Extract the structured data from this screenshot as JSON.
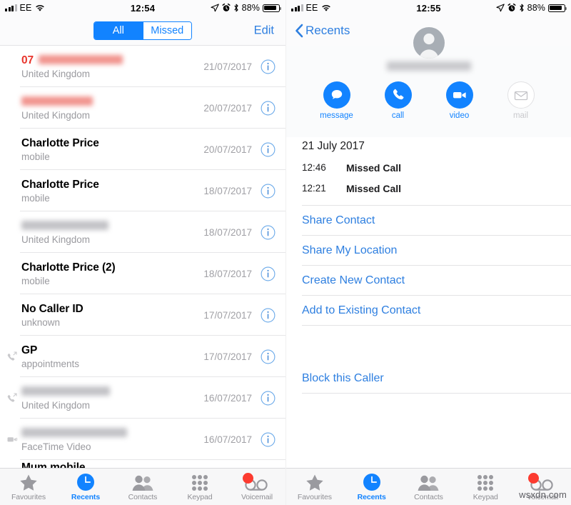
{
  "left": {
    "status_bar": {
      "carrier": "EE",
      "time": "12:54",
      "battery_percent": "88%",
      "icons": [
        "signal-bars-icon",
        "wifi-icon",
        "location-arrow-icon",
        "alarm-clock-icon",
        "bluetooth-icon",
        "battery-icon"
      ]
    },
    "nav": {
      "segments": [
        {
          "label": "All",
          "active": true
        },
        {
          "label": "Missed",
          "active": false
        }
      ],
      "edit_label": "Edit"
    },
    "calls": [
      {
        "name": "07",
        "name_redacted": true,
        "redact_color": "red",
        "redact_width": 118,
        "missed": true,
        "sub": "United Kingdom",
        "date": "21/07/2017",
        "type_icon": "none"
      },
      {
        "name": "",
        "name_redacted": true,
        "redact_color": "red",
        "redact_width": 100,
        "missed": true,
        "sub": "United Kingdom",
        "date": "20/07/2017",
        "type_icon": "none"
      },
      {
        "name": "Charlotte Price",
        "name_redacted": false,
        "missed": false,
        "sub": "mobile",
        "date": "20/07/2017",
        "type_icon": "none"
      },
      {
        "name": "Charlotte Price",
        "name_redacted": false,
        "missed": false,
        "sub": "mobile",
        "date": "18/07/2017",
        "type_icon": "none"
      },
      {
        "name": "",
        "name_redacted": true,
        "redact_color": "gray",
        "redact_width": 122,
        "missed": false,
        "sub": "United Kingdom",
        "date": "18/07/2017",
        "type_icon": "none"
      },
      {
        "name": "Charlotte Price (2)",
        "name_redacted": false,
        "missed": false,
        "sub": "mobile",
        "date": "18/07/2017",
        "type_icon": "none"
      },
      {
        "name": "No Caller ID",
        "name_redacted": false,
        "missed": false,
        "sub": "unknown",
        "date": "17/07/2017",
        "type_icon": "none"
      },
      {
        "name": "GP",
        "name_redacted": false,
        "missed": false,
        "sub": "appointments",
        "date": "17/07/2017",
        "type_icon": "outgoing-call-icon"
      },
      {
        "name": "",
        "name_redacted": true,
        "redact_color": "gray",
        "redact_width": 124,
        "missed": false,
        "sub": "United Kingdom",
        "date": "16/07/2017",
        "type_icon": "outgoing-call-icon"
      },
      {
        "name": "",
        "name_redacted": true,
        "redact_color": "gray",
        "redact_width": 148,
        "missed": false,
        "sub": "FaceTime Video",
        "date": "16/07/2017",
        "type_icon": "video-call-icon"
      }
    ],
    "tabs": [
      {
        "label": "Favourites",
        "icon": "star-icon",
        "active": false,
        "badge": ""
      },
      {
        "label": "Recents",
        "icon": "clock-icon",
        "active": true,
        "badge": ""
      },
      {
        "label": "Contacts",
        "icon": "people-icon",
        "active": false,
        "badge": ""
      },
      {
        "label": "Keypad",
        "icon": "keypad-icon",
        "active": false,
        "badge": ""
      },
      {
        "label": "Voicemail",
        "icon": "voicemail-icon",
        "active": false,
        "badge": "dot"
      }
    ]
  },
  "right": {
    "status_bar": {
      "carrier": "EE",
      "time": "12:55",
      "battery_percent": "88%"
    },
    "nav": {
      "back_label": "Recents",
      "contact_name_redacted": true
    },
    "actions": [
      {
        "label": "message",
        "icon": "message-bubble-icon",
        "enabled": true
      },
      {
        "label": "call",
        "icon": "phone-handset-icon",
        "enabled": true
      },
      {
        "label": "video",
        "icon": "video-camera-icon",
        "enabled": true
      },
      {
        "label": "mail",
        "icon": "envelope-icon",
        "enabled": false
      }
    ],
    "history": {
      "date": "21 July 2017",
      "entries": [
        {
          "time": "12:46",
          "type": "Missed Call"
        },
        {
          "time": "12:21",
          "type": "Missed Call"
        }
      ]
    },
    "links_primary": [
      "Share Contact",
      "Share My Location",
      "Create New Contact",
      "Add to Existing Contact"
    ],
    "links_secondary": [
      "Block this Caller"
    ],
    "tabs": [
      {
        "label": "Favourites",
        "icon": "star-icon",
        "active": false,
        "badge": ""
      },
      {
        "label": "Recents",
        "icon": "clock-icon",
        "active": true,
        "badge": ""
      },
      {
        "label": "Contacts",
        "icon": "people-icon",
        "active": false,
        "badge": ""
      },
      {
        "label": "Keypad",
        "icon": "keypad-icon",
        "active": false,
        "badge": ""
      },
      {
        "label": "Voicemail",
        "icon": "voicemail-icon",
        "active": false,
        "badge": "dot"
      }
    ]
  },
  "watermark": "wsxdn.com",
  "colors": {
    "accent_blue": "#1283ff",
    "link_blue": "#2e7fe0",
    "missed_red": "#e8352c",
    "badge_red": "#fc3b30",
    "subtitle_gray": "#9a9a9f"
  }
}
